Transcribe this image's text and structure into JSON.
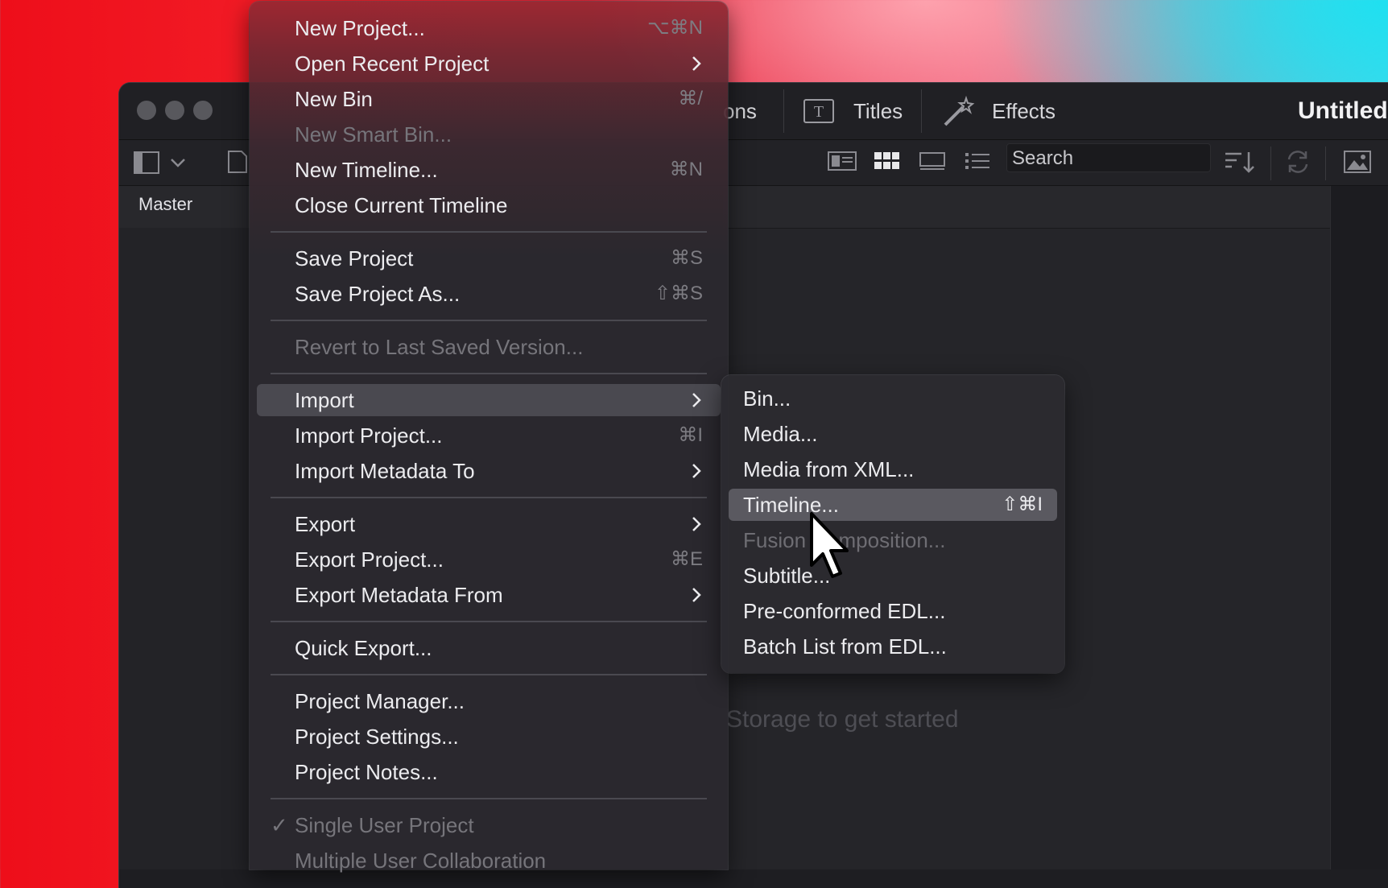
{
  "window": {
    "toolbar_tabs": [
      {
        "label": "ons",
        "icon": "transitions-icon"
      },
      {
        "label": "Titles",
        "icon": "titles-icon"
      },
      {
        "label": "Effects",
        "icon": "effects-wand-icon"
      }
    ],
    "project_title": "Untitled",
    "bin_label": "Master",
    "search_placeholder": "Search",
    "empty_hint": "Storage to get started"
  },
  "file_menu": {
    "items": [
      {
        "label": "New Project...",
        "shortcut": "⌥⌘N"
      },
      {
        "label": "Open Recent Project",
        "submenu": true
      },
      {
        "label": "New Bin",
        "shortcut": "⌘/"
      },
      {
        "label": "New Smart Bin...",
        "disabled": true
      },
      {
        "label": "New Timeline...",
        "shortcut": "⌘N"
      },
      {
        "label": "Close Current Timeline"
      },
      {
        "label": "Save Project",
        "shortcut": "⌘S"
      },
      {
        "label": "Save Project As...",
        "shortcut": "⇧⌘S"
      },
      {
        "label": "Revert to Last Saved Version...",
        "disabled": true
      },
      {
        "label": "Import",
        "submenu": true,
        "highlighted": true
      },
      {
        "label": "Import Project...",
        "shortcut": "⌘I"
      },
      {
        "label": "Import Metadata To",
        "submenu": true
      },
      {
        "label": "Export",
        "submenu": true
      },
      {
        "label": "Export Project...",
        "shortcut": "⌘E"
      },
      {
        "label": "Export Metadata From",
        "submenu": true
      },
      {
        "label": "Quick Export..."
      },
      {
        "label": "Project Manager..."
      },
      {
        "label": "Project Settings..."
      },
      {
        "label": "Project Notes..."
      },
      {
        "label": "Single User Project",
        "disabled": true,
        "checked": true
      },
      {
        "label": "Multiple User Collaboration",
        "disabled": true
      }
    ],
    "check_mark": "✓"
  },
  "import_submenu": {
    "items": [
      {
        "label": "Bin..."
      },
      {
        "label": "Media..."
      },
      {
        "label": "Media from XML..."
      },
      {
        "label": "Timeline...",
        "shortcut": "⇧⌘I",
        "highlighted": true
      },
      {
        "label": "Fusion Composition...",
        "disabled": true
      },
      {
        "label": "Subtitle..."
      },
      {
        "label": "Pre-conformed EDL..."
      },
      {
        "label": "Batch List from EDL..."
      }
    ]
  },
  "colors": {
    "menu_bg": "#2e2c32",
    "highlight": "#4a4950",
    "text": "#ececef",
    "disabled": "#76757b"
  }
}
